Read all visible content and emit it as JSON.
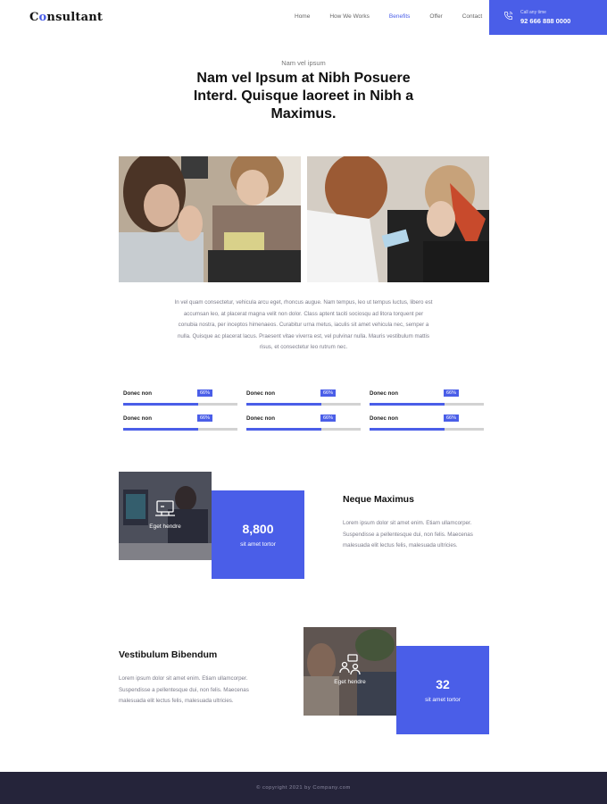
{
  "header": {
    "logo_text": "Consultant",
    "nav": [
      "Home",
      "How We Works",
      "Benefits",
      "Offer",
      "Contact"
    ],
    "active_nav": "Benefits",
    "call_label": "Call any time",
    "call_number": "92 666 888 0000",
    "accent_color": "#4a5ee8"
  },
  "hero": {
    "eyebrow": "Nam vel ipsum",
    "title": "Nam vel Ipsum at Nibh Posuere Interd. Quisque laoreet in Nibh a Maximus."
  },
  "intro_text": "In vel quam consectetur, vehicula arcu eget, rhoncus augue. Nam tempus, leo ut tempus luctus, libero est accumsan leo, at placerat magna velit non dolor. Class aptent taciti sociosqu ad litora torquent per conubia nostra, per inceptos himenaeos. Curabitur urna metus, iaculis sit amet vehicula nec, semper a nulla. Quisque ac placerat lacus. Praesent vitae viverra est, vel pulvinar nulla. Mauris vestibulum mattis risus, et consectetur leo rutrum nec.",
  "skills": [
    {
      "label": "Donec non",
      "badge": "66%",
      "value": 0.66
    },
    {
      "label": "Donec non",
      "badge": "66%",
      "value": 0.66
    },
    {
      "label": "Donec non",
      "badge": "66%",
      "value": 0.66
    },
    {
      "label": "Donec non",
      "badge": "66%",
      "value": 0.66
    },
    {
      "label": "Donec non",
      "badge": "66%",
      "value": 0.66
    },
    {
      "label": "Donec non",
      "badge": "66%",
      "value": 0.66
    }
  ],
  "feature_1": {
    "card_label": "Eget hendre",
    "card_icon": "computer-icon",
    "stat_value": "8,800",
    "stat_label": "sit amet tortor",
    "title": "Neque Maximus",
    "text": "Lorem ipsum dolor sit amet enim. Etiam ullamcorper. Suspendisse a pellentesque dui, non felis. Maecenas malesuada elit lectus felis, malesuada ultricies."
  },
  "feature_2": {
    "card_label": "Eget hendre",
    "card_icon": "meeting-icon",
    "stat_value": "32",
    "stat_label": "sit amet tortor",
    "title": "Vestibulum Bibendum",
    "text": "Lorem ipsum dolor sit amet enim. Etiam ullamcorper. Suspendisse a pellentesque dui, non felis. Maecenas malesuada elit lectus felis, malesuada ultricies."
  },
  "footer": {
    "copyright": "© copyright 2021 by Company.com"
  }
}
